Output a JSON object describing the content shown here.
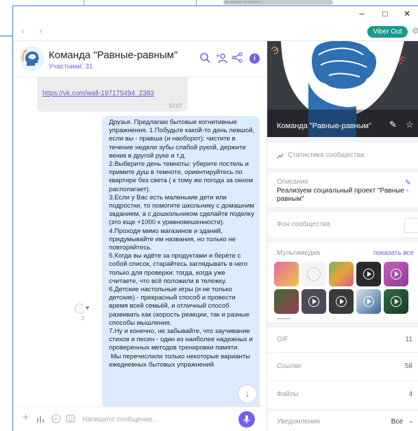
{
  "background_thumb_text": "Свет выключен   22.10.2019 в ...",
  "window": {
    "minimize": "–",
    "maximize": "□",
    "close": "✕"
  },
  "nav": {
    "back": "‹",
    "forward": "›",
    "viber_out": "Viber Out"
  },
  "chat": {
    "name": "Команда \"Равные-равным\"",
    "members": "Участники: 31"
  },
  "messages": {
    "link": "https://vk.com/wall-197175494_2383",
    "link_time": "10:07",
    "body": "Друзья. Предлагаю бытовые когнитивные упражнения. 1.Побудьте какой-то день левшой, если вы - правша (и наоборот): чистите в течение недели зубы слабой рукой, держите веник в другой руке и т.д.\n2.Выберите день темноты: уберите постель и примите душ в темноте, ориентируйтесь по квартире без света ( к тому же погода за окном располагает).\n3.Если у Вас есть маленькие дети или подростки, то помогите школьнику с домашним заданием, а с дошкольником сделайте поделку (это еще +1000 к уравновешенности).\n4.Проходя мимо магазинов и зданий, придумывайте им названия, но только не повторяйтесь.\n5.Когда вы идёте за продуктами и берёте с собой список, старайтесь заглядывать в него только для проверки: тогда, когда уже считаете, что всё положили в тележку.\n6.Детские настольные игры (и не только детские) - прекрасный способ и провести время всей семьёй, и отличный способ развивать как скорость реакции, так и разные способы мышления.\n7.Ну и конечно, не забывайте, что заучивание стихов и песен - один из наиболее надежных и проверенных методов тренировки памяти.\n Мы перечислили только некоторые варианты ежедневных бытовых упражнений",
    "reaction_count": "2"
  },
  "composer": {
    "placeholder": "Напишите сообщение..."
  },
  "panel": {
    "cover_title": "Команда \"Равные-равным\"",
    "stats": "Статистика сообщества",
    "description_title": "Описание",
    "description": "Реализуем социальный проект \"Равные - равным\"",
    "background": "Фон сообщества",
    "multimedia": "Мультимедиа",
    "show_all": "показать все",
    "gif_label": "GIF",
    "gif_count": "11",
    "links_label": "Ссылки",
    "links_count": "58",
    "files_label": "Файлы",
    "files_count": "4",
    "notifications_label": "Уведомления",
    "notifications_value": "Все"
  },
  "colors": {
    "accent": "#7360f2",
    "viber_out": "#1a9a88",
    "bubble_out": "#dcebfd",
    "bubble_in": "#ececec"
  }
}
